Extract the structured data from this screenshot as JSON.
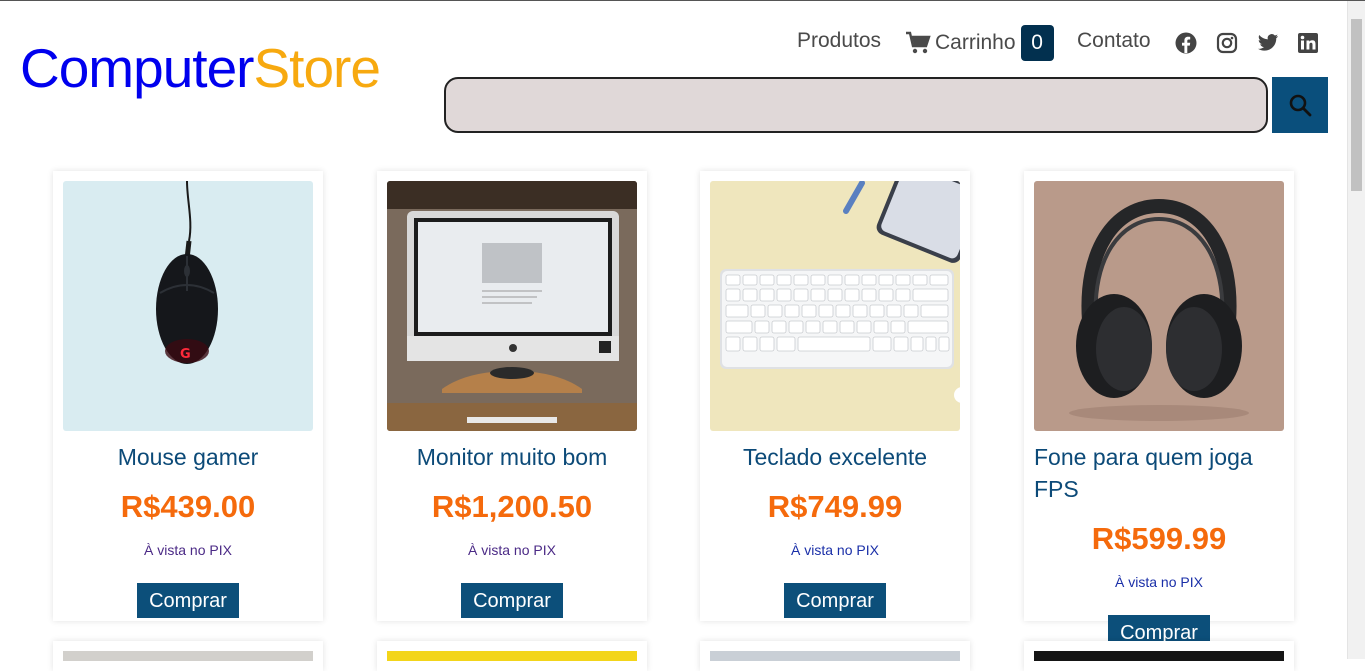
{
  "logo": {
    "part1": "Computer",
    "part2": "Store"
  },
  "nav": {
    "products": "Produtos",
    "cart": "Carrinho",
    "cart_count": "0",
    "contact": "Contato"
  },
  "social": [
    "facebook-icon",
    "instagram-icon",
    "twitter-icon",
    "linkedin-icon"
  ],
  "search": {
    "placeholder": "",
    "value": ""
  },
  "products": [
    {
      "name": "Mouse gamer",
      "price": "R$439.00",
      "payment": "À vista no PIX",
      "buy": "Comprar"
    },
    {
      "name": "Monitor muito bom",
      "price": "R$1,200.50",
      "payment": "À vista no PIX",
      "buy": "Comprar"
    },
    {
      "name": "Teclado excelente",
      "price": "R$749.99",
      "payment": "À vista no PIX",
      "buy": "Comprar"
    },
    {
      "name": "Fone para quem joga FPS",
      "price": "R$599.99",
      "payment": "À vista no PIX",
      "buy": "Comprar"
    }
  ],
  "colors": {
    "brand_blue": "#0000ee",
    "brand_orange": "#f7a90f",
    "price": "#f56a0c",
    "button": "#0c4f7a"
  }
}
